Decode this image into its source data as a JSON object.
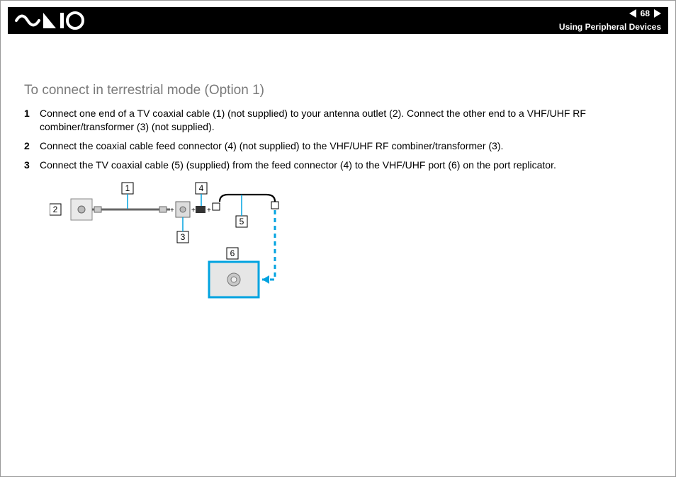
{
  "header": {
    "page_number": "68",
    "section": "Using Peripheral Devices"
  },
  "subhead": "To connect in terrestrial mode (Option 1)",
  "steps": [
    {
      "n": "1",
      "text": "Connect one end of a TV coaxial cable (1) (not supplied) to your antenna outlet (2). Connect the other end to a VHF/UHF RF combiner/transformer (3) (not supplied)."
    },
    {
      "n": "2",
      "text": "Connect the coaxial cable feed connector (4) (not supplied) to the VHF/UHF RF combiner/transformer (3)."
    },
    {
      "n": "3",
      "text": "Connect the TV coaxial cable (5) (supplied) from the feed connector (4) to the VHF/UHF port (6) on the port replicator."
    }
  ],
  "callouts": {
    "c1": "1",
    "c2": "2",
    "c3": "3",
    "c4": "4",
    "c5": "5",
    "c6": "6"
  }
}
